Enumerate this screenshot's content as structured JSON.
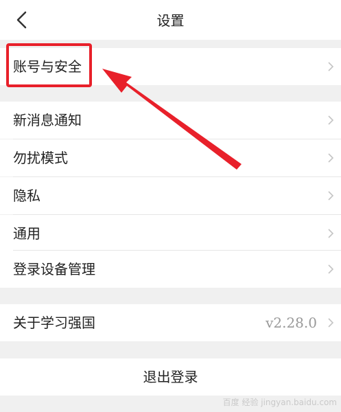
{
  "header": {
    "title": "设置"
  },
  "groups": {
    "account": {
      "label": "账号与安全"
    },
    "notifications": {
      "label": "新消息通知"
    },
    "dnd": {
      "label": "勿扰模式"
    },
    "privacy": {
      "label": "隐私"
    },
    "general": {
      "label": "通用"
    },
    "devices": {
      "label": "登录设备管理"
    },
    "about": {
      "label": "关于学习强国",
      "version": "v2.28.0"
    }
  },
  "logout": {
    "label": "退出登录"
  },
  "watermark": {
    "text": "百度 经验 jingyan.baidu.com"
  },
  "colors": {
    "annotation": "#e8202a",
    "background": "#f0f0f0"
  },
  "icons": {
    "back": "chevron-left-icon",
    "row": "chevron-right-icon"
  }
}
